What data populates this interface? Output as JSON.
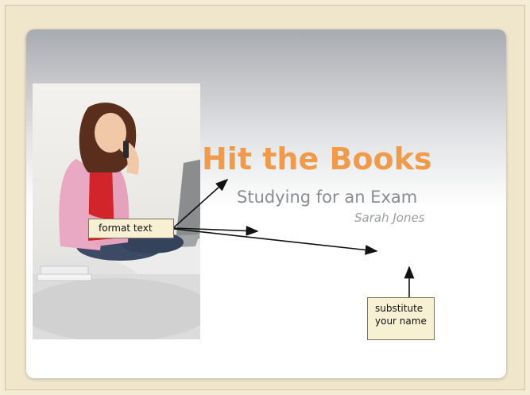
{
  "slide": {
    "title": "Hit the Books",
    "subtitle": "Studying for an Exam",
    "author": "Sarah Jones"
  },
  "callouts": {
    "format_text": "format text",
    "substitute_line1": "substitute",
    "substitute_line2": "your name"
  },
  "colors": {
    "title": "#f09a4c",
    "subtitle": "#8a8d90",
    "page_background": "#f4ecd4",
    "callout_background": "#f8f0d3"
  },
  "photo": {
    "description_icon": "woman-with-laptop-photo"
  }
}
